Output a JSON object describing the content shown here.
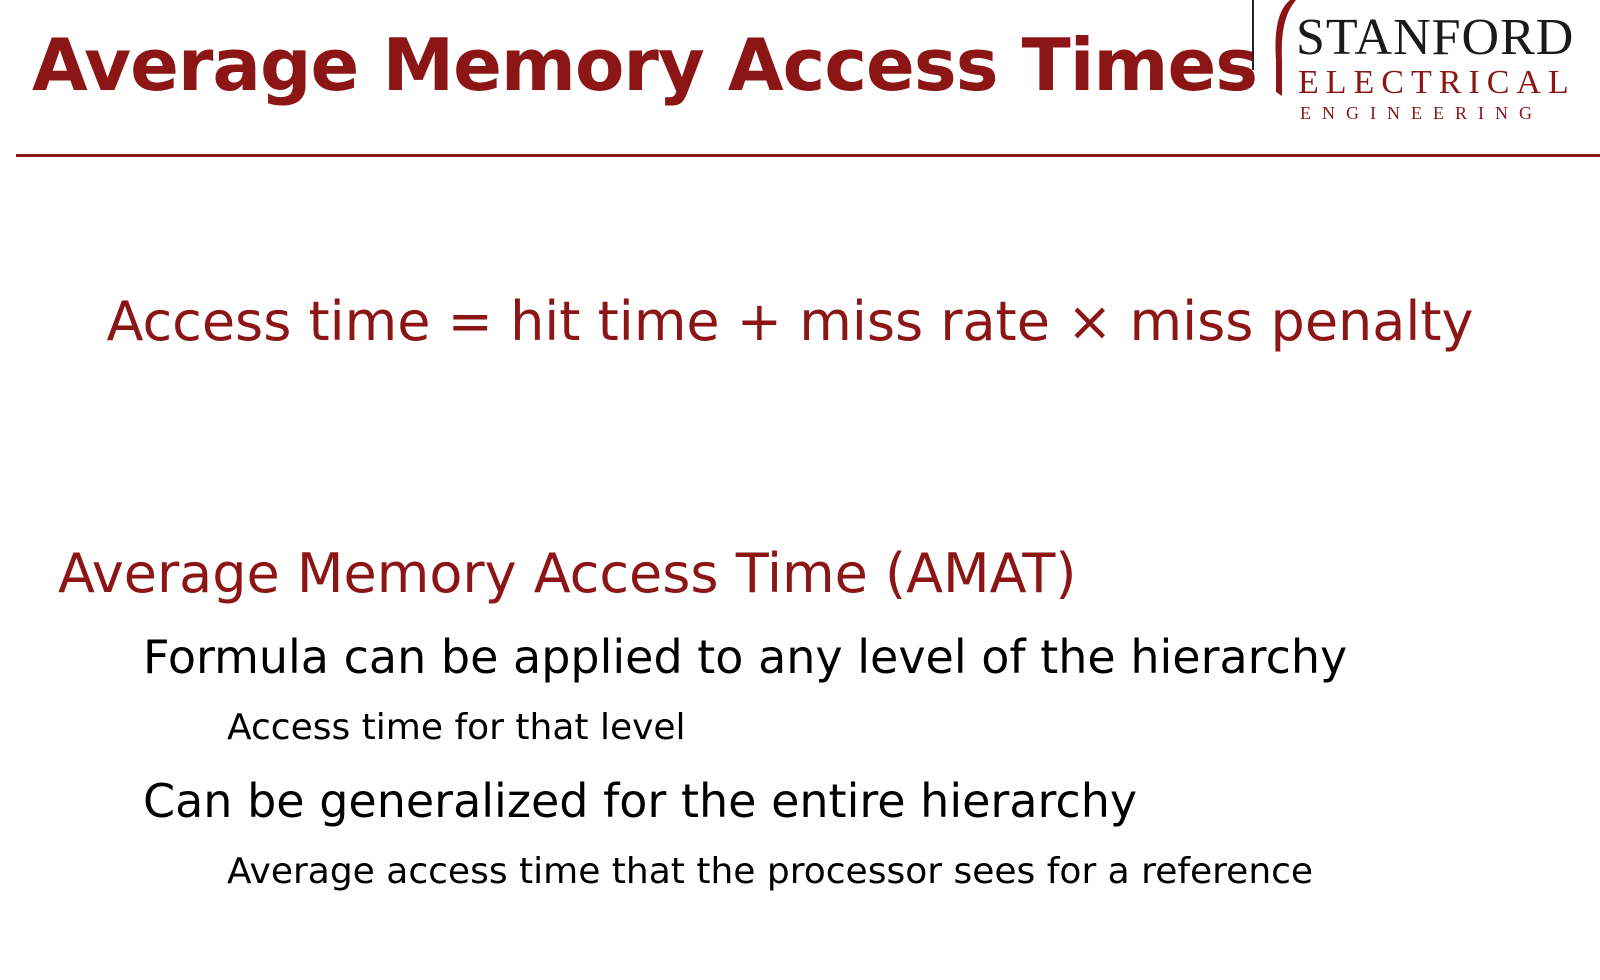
{
  "title": "Average Memory Access Times",
  "logo": {
    "line1": "STANFORD",
    "line2": "ELECTRICAL",
    "line3": "ENGINEERING",
    "color_primary": "#8c1515",
    "color_dark": "#1a1a1a"
  },
  "formula": "Access time = hit time + miss rate × miss penalty",
  "section": {
    "heading": "Average Memory Access Time (AMAT)",
    "bullets": [
      {
        "text": "Formula can be applied to any level of the hierarchy",
        "sub": "Access time for that level"
      },
      {
        "text": "Can be generalized for the entire hierarchy",
        "sub": "Average access time that the processor sees for a reference"
      }
    ]
  },
  "colors": {
    "accent": "#8c1515",
    "text": "#000000",
    "background": "#ffffff"
  }
}
